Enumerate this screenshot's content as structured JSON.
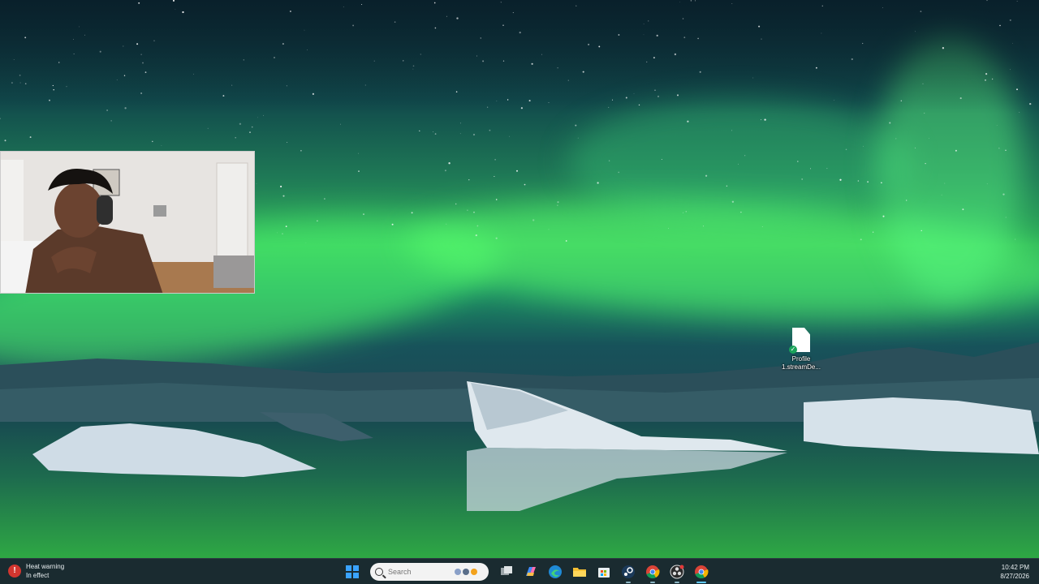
{
  "desktop": {
    "icons": [
      {
        "label": "Profile 1.streamDe...",
        "icon": "file-icon",
        "badge": "sync-ok-icon"
      }
    ]
  },
  "taskbar": {
    "weather": {
      "title": "Heat warning",
      "subtitle": "In effect",
      "icon": "heat-warning-icon"
    },
    "search": {
      "placeholder": "Search"
    },
    "apps": [
      {
        "name": "start-icon"
      },
      {
        "name": "task-view-icon"
      },
      {
        "name": "copilot-icon"
      },
      {
        "name": "edge-icon"
      },
      {
        "name": "file-explorer-icon"
      },
      {
        "name": "microsoft-store-icon"
      },
      {
        "name": "steam-icon"
      },
      {
        "name": "chrome-icon"
      },
      {
        "name": "obs-icon"
      },
      {
        "name": "chrome-icon"
      }
    ],
    "clock": {
      "time": "10:42 PM",
      "date": "8/27/2026"
    }
  },
  "colors": {
    "taskbar_bg": "#1a2b30",
    "aurora": "#4dff6e",
    "accent": "#3aa3ff"
  }
}
